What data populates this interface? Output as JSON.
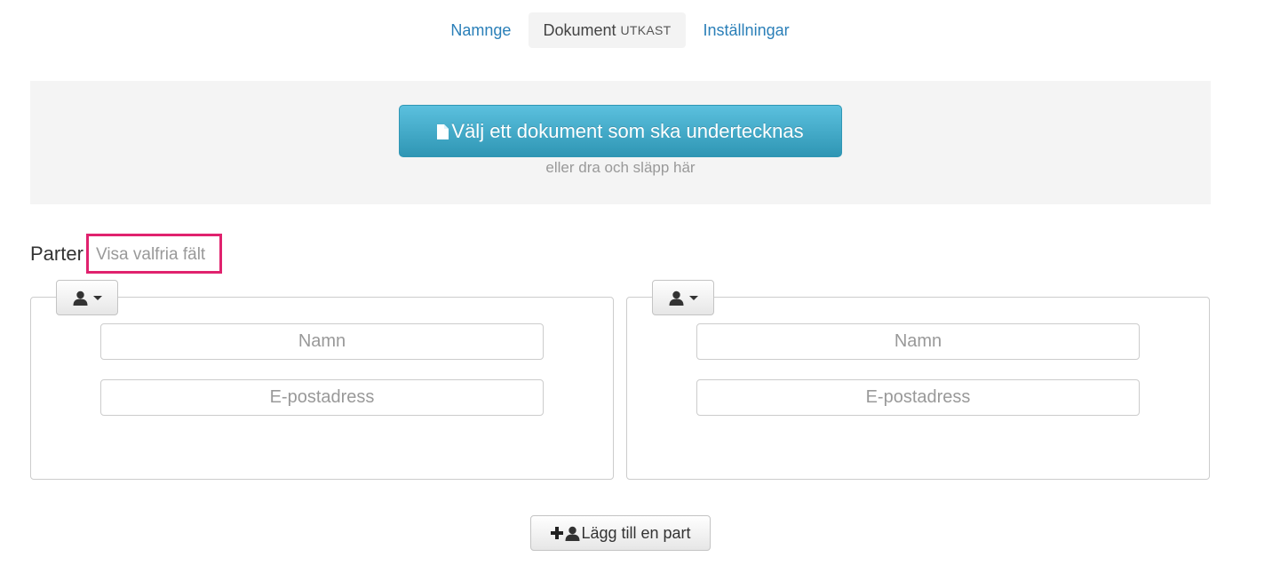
{
  "tabs": [
    {
      "label": "Namnge",
      "badge": "",
      "active": false
    },
    {
      "label": "Dokument",
      "badge": "UTKAST",
      "active": true
    },
    {
      "label": "Inställningar",
      "badge": "",
      "active": false
    }
  ],
  "upload": {
    "button_label": "Välj ett dokument som ska undertecknas",
    "button_icon": "file-icon",
    "hint": "eller dra och släpp här",
    "button_color": "#4aaed0"
  },
  "parties": {
    "heading": "Parter",
    "optional_fields_link": "Visa valfria fält",
    "highlight_color": "#e0226e",
    "cards": [
      {
        "type_icon": "user-icon",
        "name_placeholder": "Namn",
        "email_placeholder": "E-postadress"
      },
      {
        "type_icon": "user-icon",
        "name_placeholder": "Namn",
        "email_placeholder": "E-postadress"
      }
    ],
    "add_party_label": "Lägg till en part"
  },
  "colors": {
    "link": "#2a7fb8",
    "muted_text": "#999999"
  }
}
